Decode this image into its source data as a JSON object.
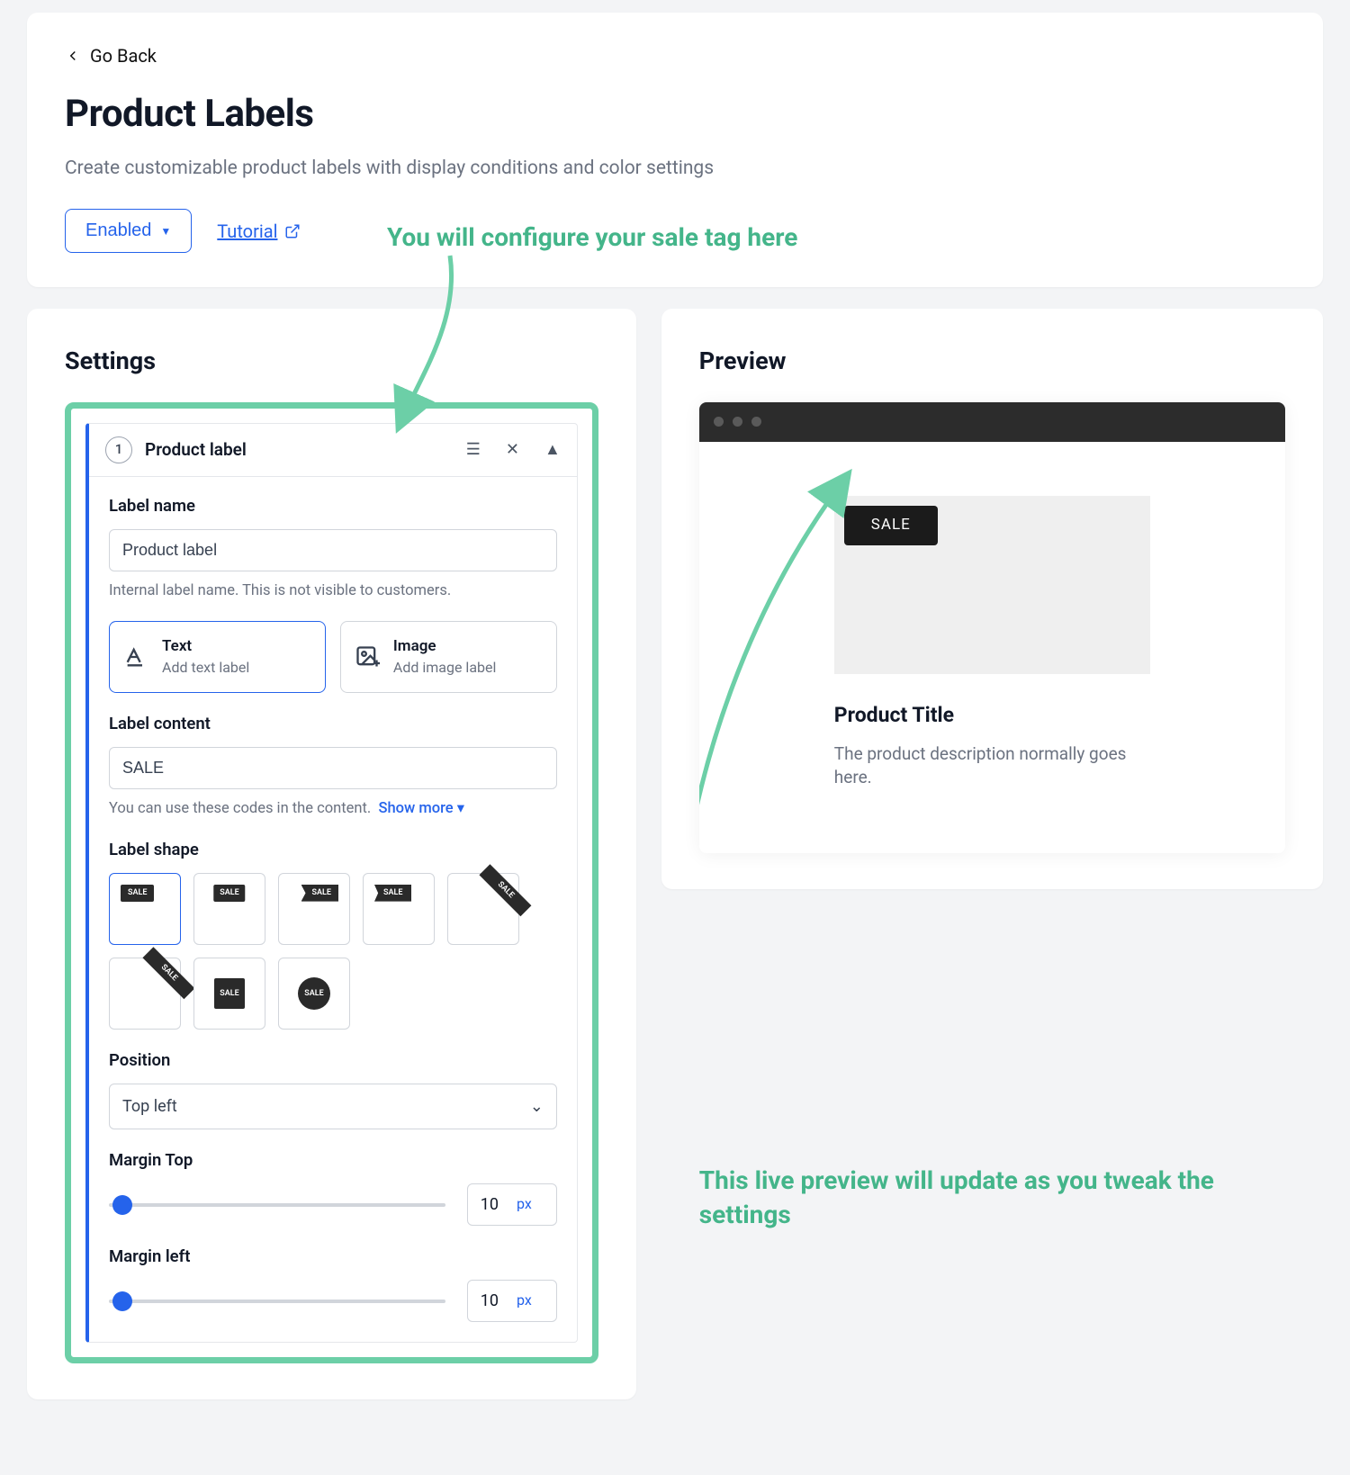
{
  "header": {
    "go_back": "Go Back",
    "title": "Product Labels",
    "subtitle": "Create customizable product labels with display conditions and color settings",
    "enabled_label": "Enabled",
    "tutorial_label": "Tutorial"
  },
  "annotations": {
    "configure": "You will configure your sale tag here",
    "preview": "This live preview will update as you tweak the settings"
  },
  "settings": {
    "heading": "Settings",
    "item_number": "1",
    "item_title": "Product label",
    "label_name": {
      "label": "Label name",
      "value": "Product label",
      "helper": "Internal label name. This is not visible to customers."
    },
    "type_options": {
      "text": {
        "title": "Text",
        "subtitle": "Add text label"
      },
      "image": {
        "title": "Image",
        "subtitle": "Add image label"
      }
    },
    "content": {
      "label": "Label content",
      "value": "SALE",
      "helper": "You can use these codes in the content.",
      "show_more": "Show more"
    },
    "shape_label": "Label shape",
    "shape_tag_text": "SALE",
    "position": {
      "label": "Position",
      "value": "Top left"
    },
    "margin_top": {
      "label": "Margin Top",
      "value": "10",
      "unit": "px"
    },
    "margin_left": {
      "label": "Margin left",
      "value": "10",
      "unit": "px"
    }
  },
  "preview": {
    "heading": "Preview",
    "sale_text": "SALE",
    "product_title": "Product Title",
    "product_desc": "The product description normally goes here."
  }
}
